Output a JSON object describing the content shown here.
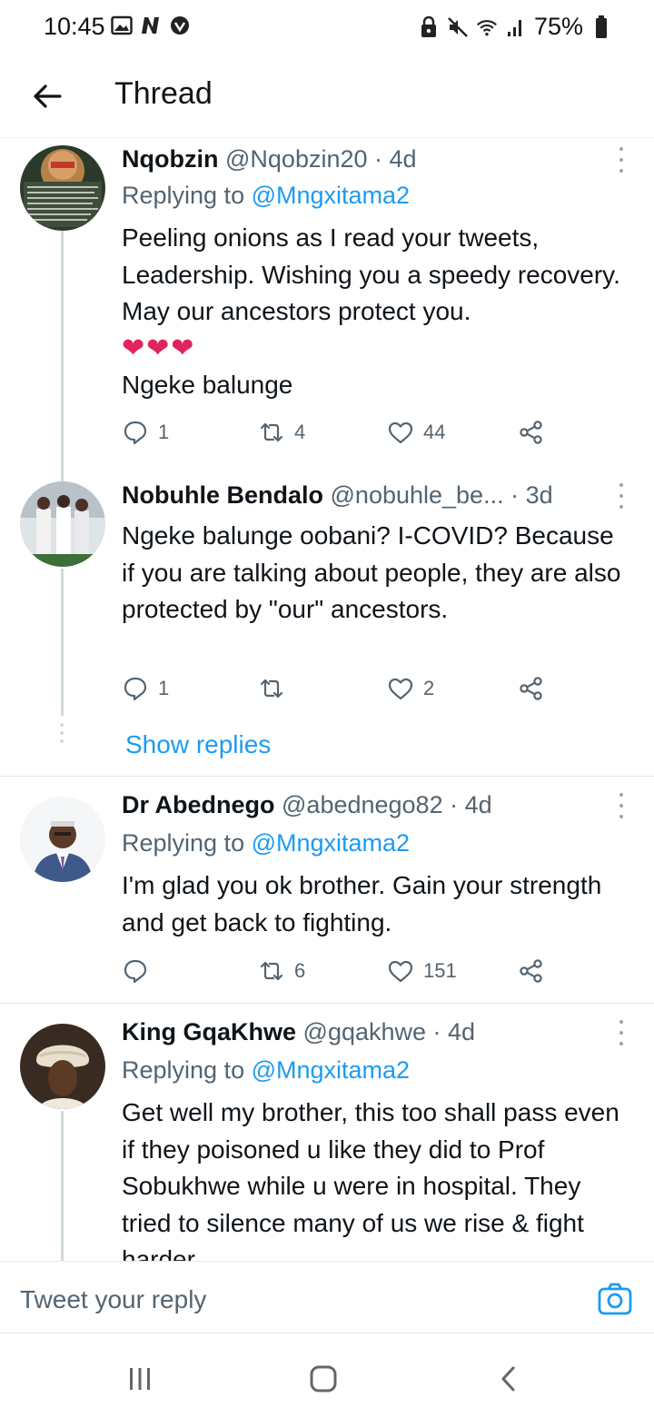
{
  "status_bar": {
    "time": "10:45",
    "battery": "75%",
    "left_icons": [
      "gallery-icon",
      "n-app-icon",
      "vpn-icon"
    ],
    "right_icons": [
      "lock-icon",
      "mute-icon",
      "wifi-icon",
      "signal-icon",
      "battery-icon"
    ]
  },
  "header": {
    "title": "Thread"
  },
  "tweets": [
    {
      "name": "Nqobzin",
      "meta": "@Nqobzin20 · 4d",
      "replying_prefix": "Replying to ",
      "replying_handle": "@Mngxitama2",
      "body": "Peeling onions as I read your tweets, Leadership. Wishing you a speedy recovery. May our ancestors protect you.",
      "hearts": "❤❤❤",
      "body2": "Ngeke balunge",
      "replies": "1",
      "retweets": "4",
      "likes": "44"
    },
    {
      "name": "Nobuhle Bendalo",
      "meta": "@nobuhle_be... · 3d",
      "body": "Ngeke balunge oobani? I-COVID? Because if you are talking about people, they are also protected by \"our\" ancestors.",
      "replies": "1",
      "retweets": "",
      "likes": "2",
      "show_replies": "Show replies"
    },
    {
      "name": "Dr Abednego",
      "meta": "@abednego82 · 4d",
      "replying_prefix": "Replying to ",
      "replying_handle": "@Mngxitama2",
      "body": "I'm glad you ok brother. Gain your strength and get back to fighting.",
      "replies": "",
      "retweets": "6",
      "likes": "151"
    },
    {
      "name": "King GqaKhwe",
      "meta": "@gqakhwe · 4d",
      "replying_prefix": "Replying to ",
      "replying_handle": "@Mngxitama2",
      "body": "Get well my brother, this too shall pass even if they poisoned u like they did to Prof Sobukhwe while u were in hospital. They tried to silence many of us we rise & fight harder"
    }
  ],
  "reply_bar": {
    "placeholder": "Tweet your reply"
  },
  "colors": {
    "accent": "#1d9bf0",
    "heart": "#e0245e",
    "secondary_text": "#536471"
  }
}
